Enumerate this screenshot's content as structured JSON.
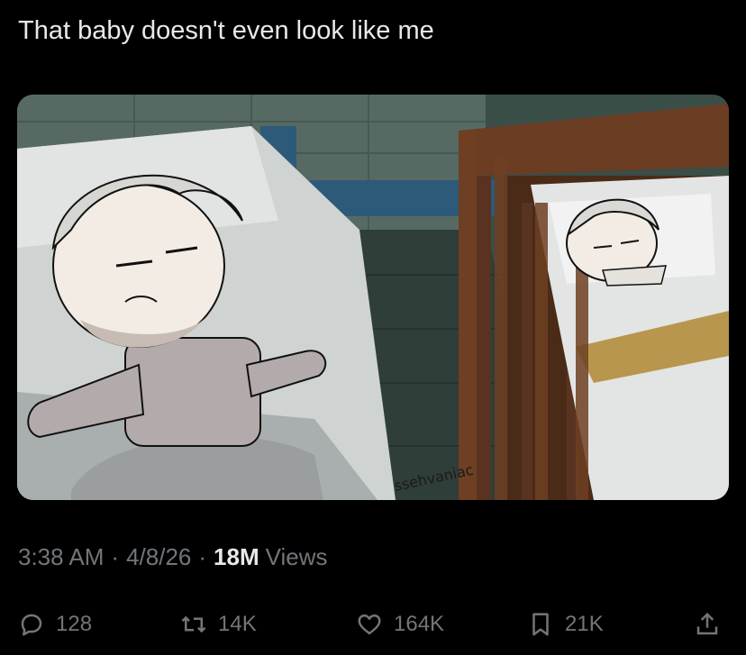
{
  "tweet": {
    "text": "That baby doesn't even look like me"
  },
  "media": {
    "watermark": "ssehvaniac"
  },
  "meta": {
    "time": "3:38 AM",
    "separator": "·",
    "date": "4/8/26",
    "views_count": "18M",
    "views_label": "Views"
  },
  "actions": {
    "replies": "128",
    "reposts": "14K",
    "likes": "164K",
    "bookmarks": "21K"
  },
  "colors": {
    "background": "#000000",
    "text_primary": "#e7e9ea",
    "text_secondary": "#71767b"
  },
  "icons": [
    "reply-icon",
    "repost-icon",
    "like-icon",
    "bookmark-icon",
    "share-icon"
  ]
}
